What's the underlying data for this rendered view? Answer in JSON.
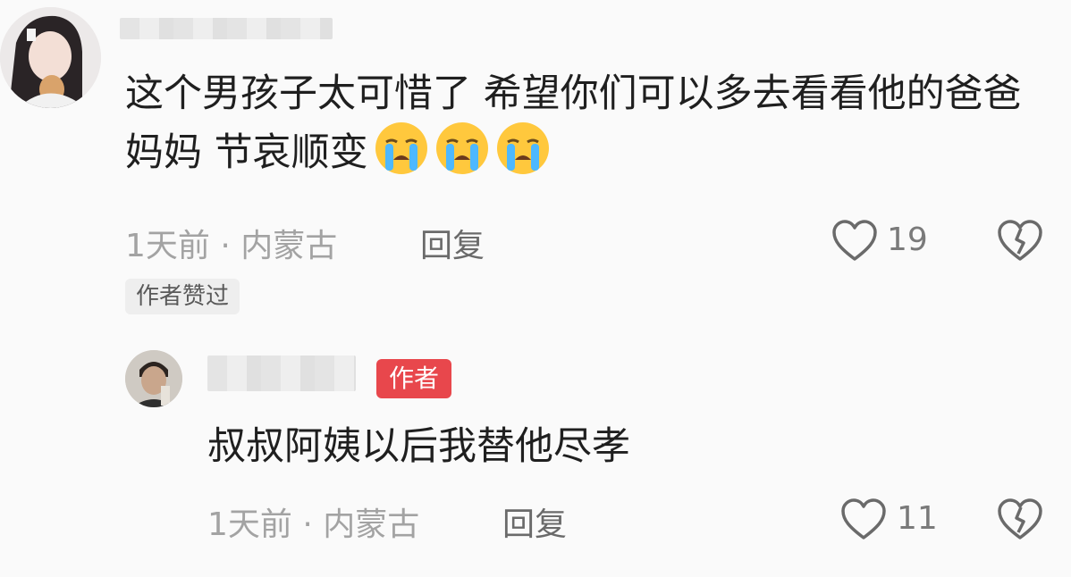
{
  "comments": [
    {
      "text": "这个男孩子太可惜了 希望你们可以多去看看他的爸爸妈妈 节哀顺变",
      "emoji": "loudly-crying-face",
      "emoji_count": 3,
      "meta": "1天前 · 内蒙古",
      "reply_label": "回复",
      "likes": "19",
      "author_liked_label": "作者赞过"
    }
  ],
  "replies": [
    {
      "badge": "作者",
      "text": "叔叔阿姨以后我替他尽孝",
      "meta": "1天前 · 内蒙古",
      "reply_label": "回复",
      "likes": "11"
    }
  ],
  "icons": {
    "like": "heart-outline-icon",
    "dislike": "broken-heart-icon"
  },
  "colors": {
    "author_badge": "#e8474c",
    "text": "#1f1f1f",
    "meta": "#a3a3a3"
  }
}
